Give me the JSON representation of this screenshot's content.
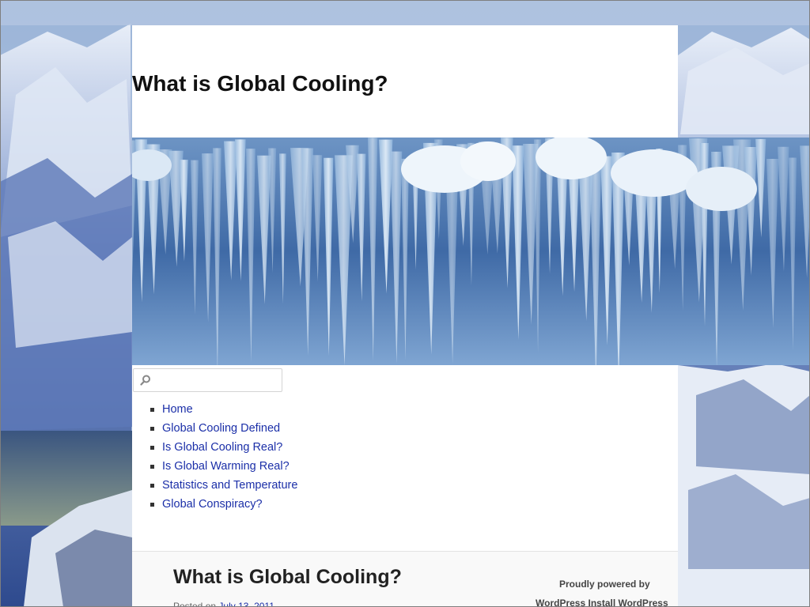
{
  "site": {
    "title": "What is Global Cooling?"
  },
  "search": {
    "placeholder": "",
    "value": ""
  },
  "nav": {
    "items": [
      {
        "label": "Home"
      },
      {
        "label": "Global Cooling Defined"
      },
      {
        "label": "Is Global Cooling Real?"
      },
      {
        "label": "Is Global Warming Real?"
      },
      {
        "label": "Statistics and Temperature"
      },
      {
        "label": "Global Conspiracy?"
      }
    ]
  },
  "post": {
    "title": "What is Global Cooling?",
    "meta_prefix": "Posted on",
    "meta_date": "July 13, 2011"
  },
  "sidebar": {
    "powered_by": "Proudly powered by",
    "link_1": "WordPress",
    "link_2": "Install WordPress"
  },
  "colors": {
    "link": "#1b2fa8",
    "title": "#111111",
    "page_bg": "#ffffff"
  },
  "icons": {
    "search": "search-icon"
  }
}
